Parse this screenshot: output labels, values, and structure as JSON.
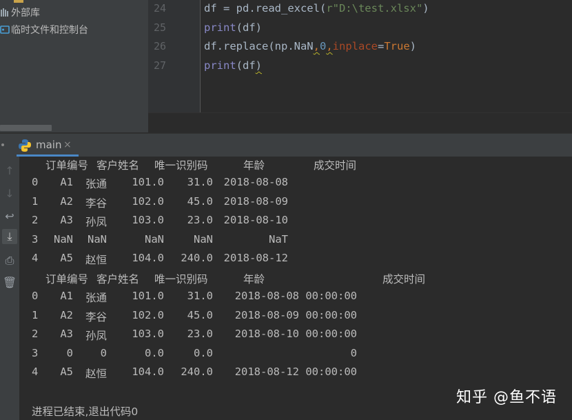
{
  "project_tree": {
    "items": [
      {
        "label": "外部库",
        "icon": "library-icon"
      },
      {
        "label": "临时文件和控制台",
        "icon": "scratch-console-icon"
      }
    ]
  },
  "editor": {
    "line_numbers": [
      "24",
      "25",
      "26",
      "27"
    ],
    "lines": [
      {
        "segments": [
          {
            "t": "df = pd.read_excel(",
            "c": ""
          },
          {
            "t": "r\"D:\\test.xlsx\"",
            "c": "str"
          },
          {
            "t": ")",
            "c": ""
          }
        ]
      },
      {
        "segments": [
          {
            "t": "print",
            "c": "fn"
          },
          {
            "t": "(df)",
            "c": ""
          }
        ]
      },
      {
        "segments": [
          {
            "t": "df.replace(np.NaN",
            "c": ""
          },
          {
            "t": ",",
            "c": "kw squig"
          },
          {
            "t": "0",
            "c": "num"
          },
          {
            "t": ",",
            "c": "kw squig"
          },
          {
            "t": "inplace",
            "c": "par"
          },
          {
            "t": "=",
            "c": ""
          },
          {
            "t": "True",
            "c": "kw"
          },
          {
            "t": ")",
            "c": ""
          }
        ]
      },
      {
        "segments": [
          {
            "t": "print",
            "c": "fn"
          },
          {
            "t": "(df",
            "c": ""
          },
          {
            "t": ")",
            "c": "squig"
          }
        ]
      }
    ]
  },
  "run_window": {
    "tab_label": "main",
    "close_glyph": "×",
    "toolbar": [
      {
        "name": "rerun-up-icon",
        "glyph": "↑"
      },
      {
        "name": "down-arrow-icon",
        "glyph": "↓"
      },
      {
        "name": "soft-wrap-icon",
        "glyph": "↩"
      },
      {
        "name": "scroll-to-end-icon",
        "glyph": "⤓"
      },
      {
        "name": "print-icon",
        "glyph": "⎙"
      },
      {
        "name": "trash-icon",
        "glyph": "🗑"
      }
    ]
  },
  "console": {
    "table1": {
      "headers": [
        "订单编号",
        "客户姓名",
        "唯一识别码",
        "年龄",
        "成交时间"
      ],
      "rows": [
        [
          "0",
          "A1",
          "张通",
          "101.0",
          "31.0",
          "2018-08-08"
        ],
        [
          "1",
          "A2",
          "李谷",
          "102.0",
          "45.0",
          "2018-08-09"
        ],
        [
          "2",
          "A3",
          "孙凤",
          "103.0",
          "23.0",
          "2018-08-10"
        ],
        [
          "3",
          "NaN",
          "NaN",
          "NaN",
          "NaN",
          "NaT"
        ],
        [
          "4",
          "A5",
          "赵恒",
          "104.0",
          "240.0",
          "2018-08-12"
        ]
      ]
    },
    "table2": {
      "headers": [
        "订单编号",
        "客户姓名",
        "唯一识别码",
        "年龄",
        "成交时间"
      ],
      "rows": [
        [
          "0",
          "A1",
          "张通",
          "101.0",
          "31.0",
          "2018-08-08 00:00:00"
        ],
        [
          "1",
          "A2",
          "李谷",
          "102.0",
          "45.0",
          "2018-08-09 00:00:00"
        ],
        [
          "2",
          "A3",
          "孙凤",
          "103.0",
          "23.0",
          "2018-08-10 00:00:00"
        ],
        [
          "3",
          "0",
          "0",
          "0.0",
          "0.0",
          "0"
        ],
        [
          "4",
          "A5",
          "赵恒",
          "104.0",
          "240.0",
          "2018-08-12 00:00:00"
        ]
      ]
    },
    "exit_message": "进程已结束,退出代码0"
  },
  "watermark": "知乎 @鱼不语"
}
